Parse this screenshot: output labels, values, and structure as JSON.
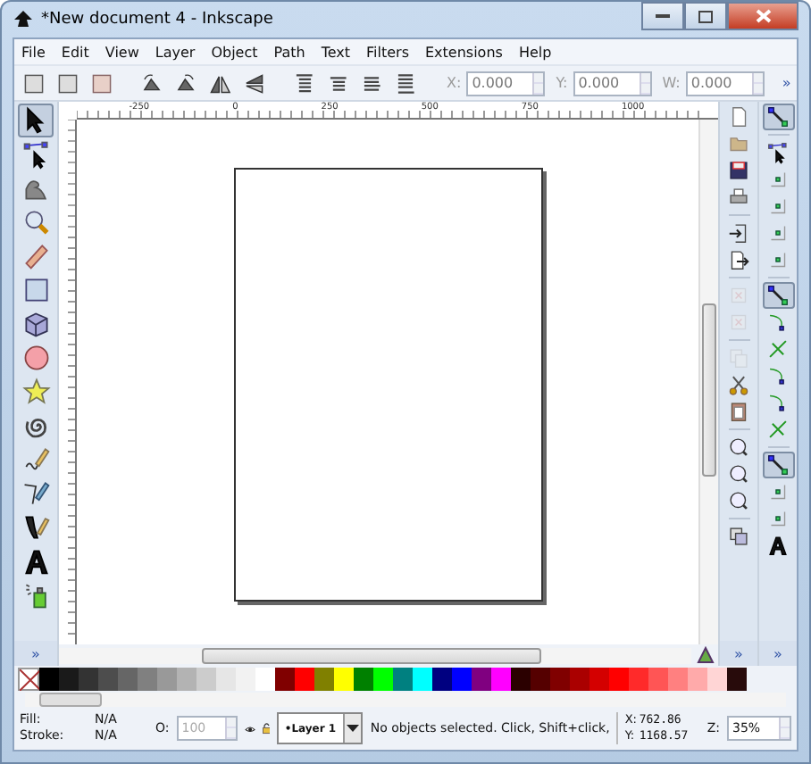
{
  "window": {
    "title": "*New document 4 - Inkscape"
  },
  "menu": [
    {
      "label": "File"
    },
    {
      "label": "Edit"
    },
    {
      "label": "View"
    },
    {
      "label": "Layer"
    },
    {
      "label": "Object"
    },
    {
      "label": "Path"
    },
    {
      "label": "Text"
    },
    {
      "label": "Filters"
    },
    {
      "label": "Extensions"
    },
    {
      "label": "Help"
    }
  ],
  "toolbar": {
    "icons": [
      {
        "kind": "selall"
      },
      {
        "kind": "selall"
      },
      {
        "kind": "deselect"
      },
      {
        "kind": "sep"
      },
      {
        "kind": "rotl"
      },
      {
        "kind": "rotr"
      },
      {
        "kind": "fliph"
      },
      {
        "kind": "flipv"
      },
      {
        "kind": "sep"
      },
      {
        "kind": "top"
      },
      {
        "kind": "raise"
      },
      {
        "kind": "lower"
      },
      {
        "kind": "bottom"
      }
    ],
    "fields": [
      {
        "label": "X:",
        "value": "0.000"
      },
      {
        "label": "Y:",
        "value": "0.000"
      },
      {
        "label": "W:",
        "value": "0.000"
      }
    ],
    "more": "»"
  },
  "tools": [
    {
      "kind": "select",
      "selected": true
    },
    {
      "kind": "node",
      "selected": false
    },
    {
      "kind": "tweak",
      "selected": false
    },
    {
      "kind": "zoom",
      "selected": false
    },
    {
      "kind": "measure",
      "selected": false
    },
    {
      "kind": "rect",
      "selected": false
    },
    {
      "kind": "box",
      "selected": false
    },
    {
      "kind": "ellipse",
      "selected": false
    },
    {
      "kind": "star",
      "selected": false
    },
    {
      "kind": "spiral",
      "selected": false
    },
    {
      "kind": "pencil",
      "selected": false
    },
    {
      "kind": "pen",
      "selected": false
    },
    {
      "kind": "callig",
      "selected": false
    },
    {
      "kind": "text",
      "selected": false
    },
    {
      "kind": "spray",
      "selected": false
    }
  ],
  "ruler": {
    "labels": [
      "-250",
      "0",
      "250",
      "500",
      "750",
      "1000"
    ]
  },
  "commands": [
    {
      "kind": "new",
      "disabled": false
    },
    {
      "kind": "open",
      "disabled": false
    },
    {
      "kind": "save",
      "disabled": false
    },
    {
      "kind": "print",
      "disabled": false
    },
    {
      "kind": "sep"
    },
    {
      "kind": "import",
      "disabled": false
    },
    {
      "kind": "export",
      "disabled": false
    },
    {
      "kind": "sep"
    },
    {
      "kind": "undo",
      "disabled": true
    },
    {
      "kind": "redo",
      "disabled": true
    },
    {
      "kind": "sep"
    },
    {
      "kind": "dup",
      "disabled": true
    },
    {
      "kind": "cut",
      "disabled": false
    },
    {
      "kind": "paste",
      "disabled": false
    },
    {
      "kind": "sep"
    },
    {
      "kind": "zoomsel",
      "disabled": false
    },
    {
      "kind": "zoomdraw",
      "disabled": false
    },
    {
      "kind": "zoompage",
      "disabled": false
    },
    {
      "kind": "sep"
    },
    {
      "kind": "clone",
      "disabled": false
    }
  ],
  "snap": [
    {
      "kind": "snap",
      "selected": true
    },
    {
      "kind": "sep"
    },
    {
      "kind": "node",
      "selected": false
    },
    {
      "kind": "bbox",
      "selected": false
    },
    {
      "kind": "bbox",
      "selected": false
    },
    {
      "kind": "bbox",
      "selected": false
    },
    {
      "kind": "bbox",
      "selected": false
    },
    {
      "kind": "sep"
    },
    {
      "kind": "snap",
      "selected": true
    },
    {
      "kind": "curve",
      "selected": false
    },
    {
      "kind": "cross",
      "selected": false
    },
    {
      "kind": "curve",
      "selected": false
    },
    {
      "kind": "curve",
      "selected": false
    },
    {
      "kind": "cross",
      "selected": false
    },
    {
      "kind": "sep"
    },
    {
      "kind": "snap",
      "selected": true
    },
    {
      "kind": "bbox",
      "selected": false
    },
    {
      "kind": "bbox",
      "selected": false
    },
    {
      "kind": "text",
      "selected": false
    }
  ],
  "more_buttons": [
    "»",
    "»",
    "»"
  ],
  "palette": {
    "none": true,
    "colors": [
      {
        "color": "#000000"
      },
      {
        "color": "#1a1a1a"
      },
      {
        "color": "#333333"
      },
      {
        "color": "#4d4d4d"
      },
      {
        "color": "#666666"
      },
      {
        "color": "#808080"
      },
      {
        "color": "#999999"
      },
      {
        "color": "#b3b3b3"
      },
      {
        "color": "#cccccc"
      },
      {
        "color": "#e6e6e6"
      },
      {
        "color": "#f2f2f2"
      },
      {
        "color": "#ffffff"
      },
      {
        "color": "#800000"
      },
      {
        "color": "#ff0000"
      },
      {
        "color": "#808000"
      },
      {
        "color": "#ffff00"
      },
      {
        "color": "#008000"
      },
      {
        "color": "#00ff00"
      },
      {
        "color": "#008080"
      },
      {
        "color": "#00ffff"
      },
      {
        "color": "#000080"
      },
      {
        "color": "#0000ff"
      },
      {
        "color": "#800080"
      },
      {
        "color": "#ff00ff"
      },
      {
        "color": "#2b0000"
      },
      {
        "color": "#550000"
      },
      {
        "color": "#800000"
      },
      {
        "color": "#aa0000"
      },
      {
        "color": "#d40000"
      },
      {
        "color": "#ff0000"
      },
      {
        "color": "#ff2a2a"
      },
      {
        "color": "#ff5555"
      },
      {
        "color": "#ff8080"
      },
      {
        "color": "#ffaaaa"
      },
      {
        "color": "#ffd5d5"
      },
      {
        "color": "#280b0b"
      }
    ]
  },
  "status": {
    "fill_label": "Fill:",
    "fill_value": "N/A",
    "stroke_label": "Stroke:",
    "stroke_value": "N/A",
    "opacity_label": "O:",
    "opacity_value": "100",
    "layer": "•Layer 1",
    "message": "No objects selected. Click, Shift+click,",
    "x_label": "X:",
    "x_value": "762.86",
    "y_label": "Y:",
    "y_value": "1168.57",
    "zoom_label": "Z:",
    "zoom_value": "35%"
  }
}
